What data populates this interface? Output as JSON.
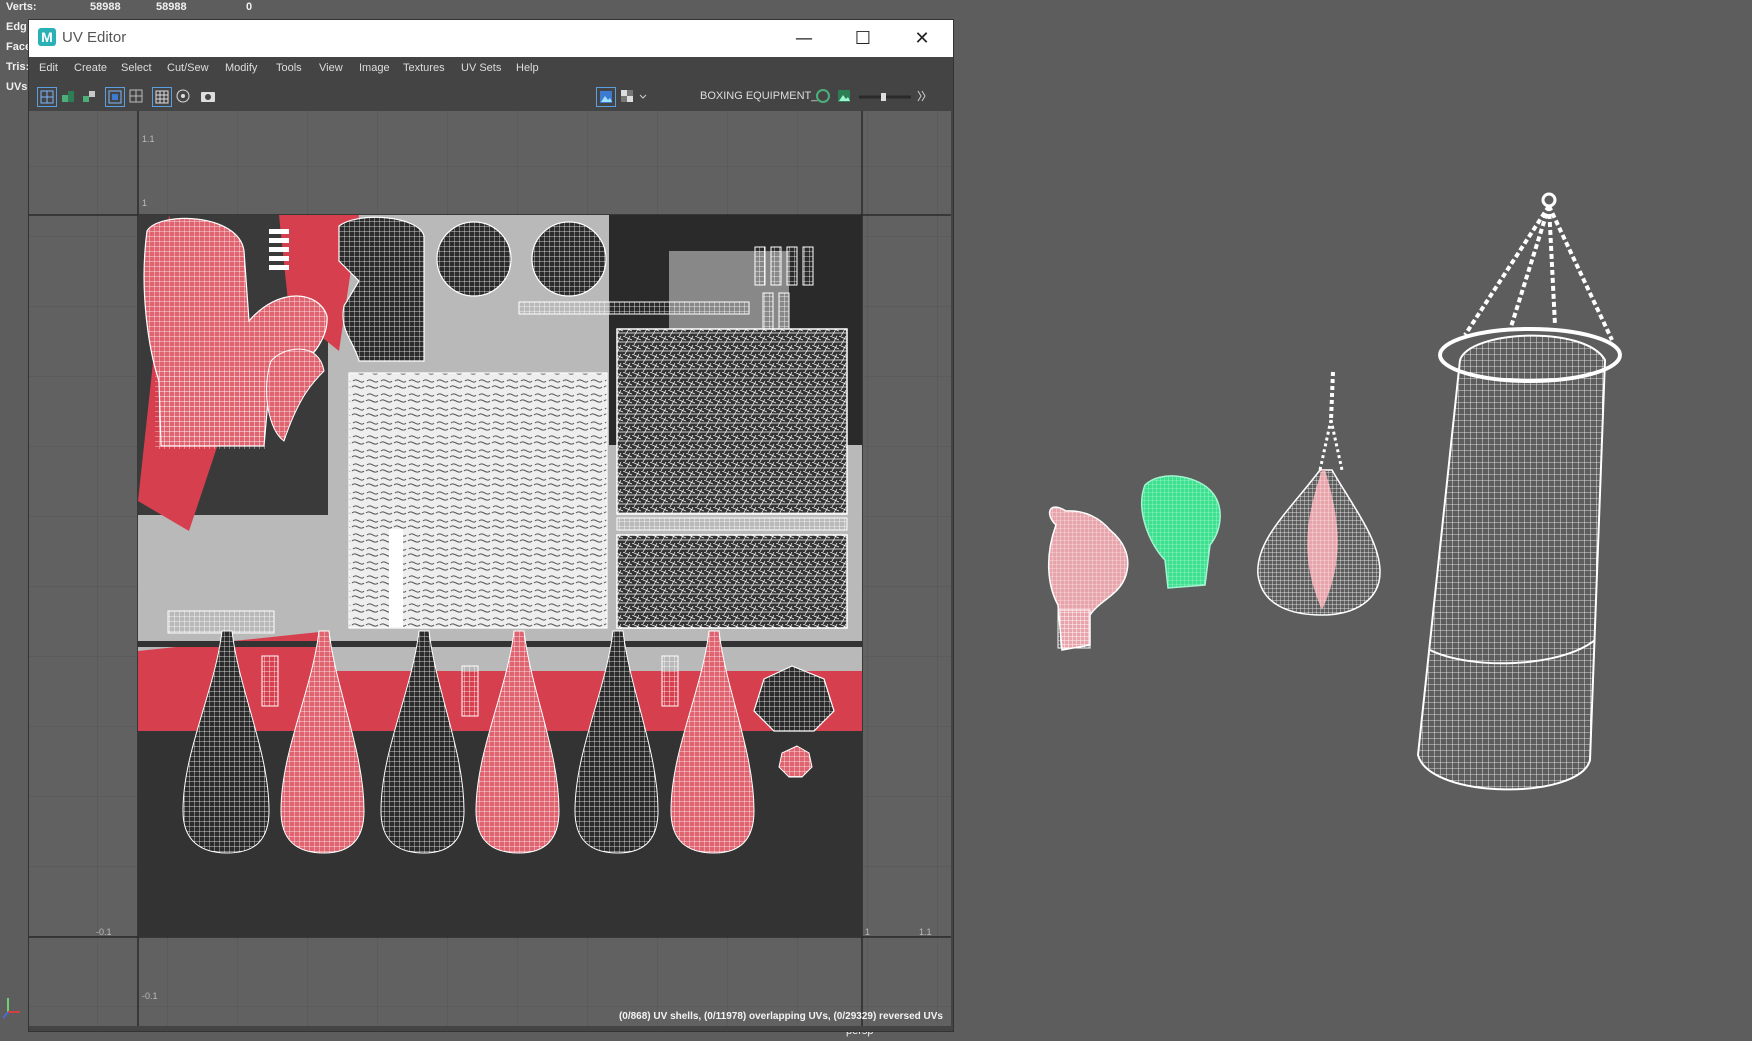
{
  "hud": {
    "verts_label": "Verts:",
    "verts_a": "58988",
    "verts_b": "58988",
    "verts_c": "0",
    "edges_label": "Edg",
    "faces_label": "Face",
    "tris_label": "Tris:",
    "uvs_label": "UVs:"
  },
  "viewport": {
    "camera_label": "persp"
  },
  "uv_editor": {
    "app_icon": "M",
    "title": "UV Editor",
    "window_buttons": {
      "minimize": "—",
      "maximize": "☐",
      "close": "✕"
    },
    "menus": [
      "Edit",
      "Create",
      "Select",
      "Cut/Sew",
      "Modify",
      "Tools",
      "View",
      "Image",
      "Textures",
      "UV Sets",
      "Help"
    ],
    "texture_name": "BOXING EQUIPMENT_",
    "axis_labels": {
      "top": "1.1",
      "one": "1",
      "left_neg": "-0.1",
      "right_pos": "1.1",
      "bottom_neg": "-0.1",
      "right_one": "1"
    },
    "status": "(0/868) UV shells, (0/11978) overlapping UVs, (0/29329) reversed UVs"
  },
  "colors": {
    "uv_pink": "#e06470",
    "selected_green": "#3de08f",
    "mesh_white": "#ffffff",
    "texture_red": "#d6404e"
  }
}
